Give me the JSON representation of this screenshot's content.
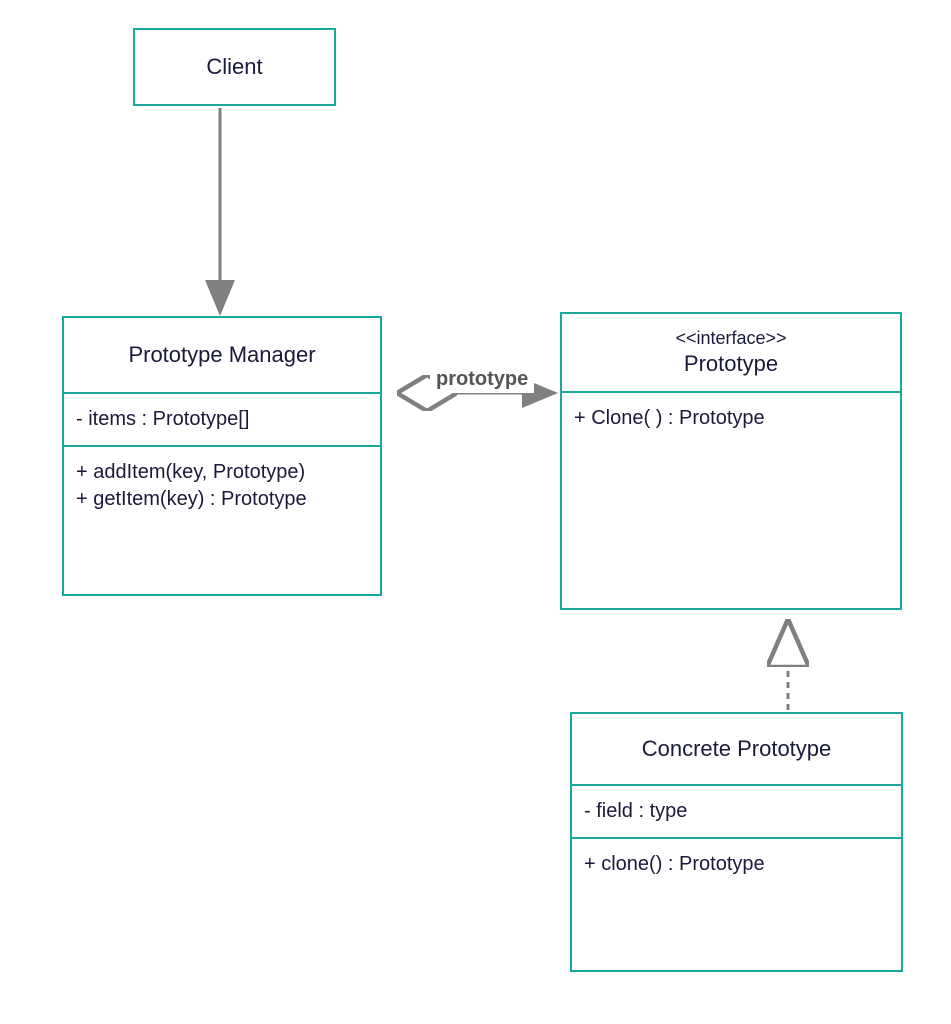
{
  "diagram": {
    "type": "uml-class",
    "pattern": "Prototype",
    "colors": {
      "border": "#1aa89e",
      "text": "#1a1a3a",
      "arrow": "#808080"
    }
  },
  "boxes": {
    "client": {
      "title": "Client"
    },
    "manager": {
      "title": "Prototype Manager",
      "attr0": "- items : Prototype[]",
      "op0": "+ addItem(key, Prototype)",
      "op1": "+ getItem(key) : Prototype"
    },
    "prototype": {
      "stereotype": "<<interface>>",
      "title": "Prototype",
      "op0": "+ Clone( ) : Prototype"
    },
    "concrete": {
      "title": "Concrete Prototype",
      "attr0": "- field : type",
      "op0": "+ clone() : Prototype"
    }
  },
  "labels": {
    "assoc_prototype": "prototype"
  },
  "relations": [
    {
      "from": "client",
      "to": "manager",
      "kind": "dependency"
    },
    {
      "from": "manager",
      "to": "prototype",
      "kind": "aggregation-arrow",
      "label": "prototype"
    },
    {
      "from": "concrete",
      "to": "prototype",
      "kind": "realization"
    }
  ]
}
